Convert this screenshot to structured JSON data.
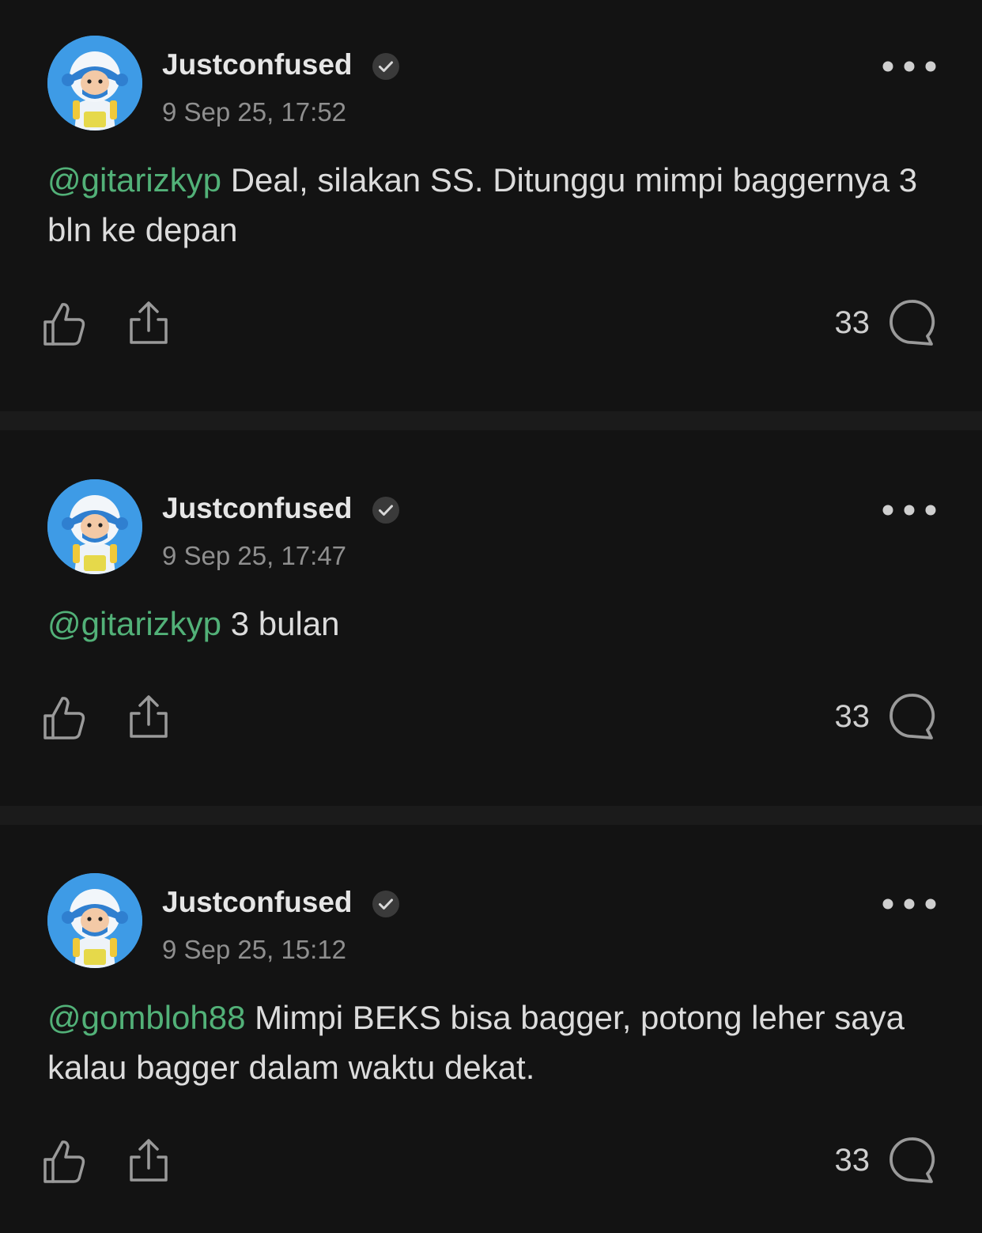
{
  "posts": [
    {
      "username": "Justconfused",
      "timestamp": "9 Sep 25, 17:52",
      "mention": "@gitarizkyp",
      "text": " Deal, silakan SS. Ditunggu mimpi baggernya 3 bln ke depan",
      "comment_count": "33",
      "icons": [
        "avatar-astronaut",
        "verified-check-icon",
        "more-dots-icon",
        "thumbs-up-icon",
        "share-icon",
        "comment-bubble-icon"
      ]
    },
    {
      "username": "Justconfused",
      "timestamp": "9 Sep 25, 17:47",
      "mention": "@gitarizkyp",
      "text": " 3 bulan",
      "comment_count": "33",
      "icons": [
        "avatar-astronaut",
        "verified-check-icon",
        "more-dots-icon",
        "thumbs-up-icon",
        "share-icon",
        "comment-bubble-icon"
      ]
    },
    {
      "username": "Justconfused",
      "timestamp": "9 Sep 25, 15:12",
      "mention": "@gombloh88",
      "text": " Mimpi BEKS bisa bagger, potong leher saya kalau bagger dalam waktu dekat.",
      "comment_count": "33",
      "icons": [
        "avatar-astronaut",
        "verified-check-icon",
        "more-dots-icon",
        "thumbs-up-icon",
        "share-icon",
        "comment-bubble-icon"
      ]
    }
  ],
  "colors": {
    "background": "#131313",
    "divider": "#1b1b1b",
    "mention": "#52b178",
    "username": "#e6e6e6",
    "timestamp": "#8f8f8f",
    "body_text": "#dcdcdc",
    "icon": "#9a9a9a",
    "avatar_bg": "#3e9be6"
  }
}
